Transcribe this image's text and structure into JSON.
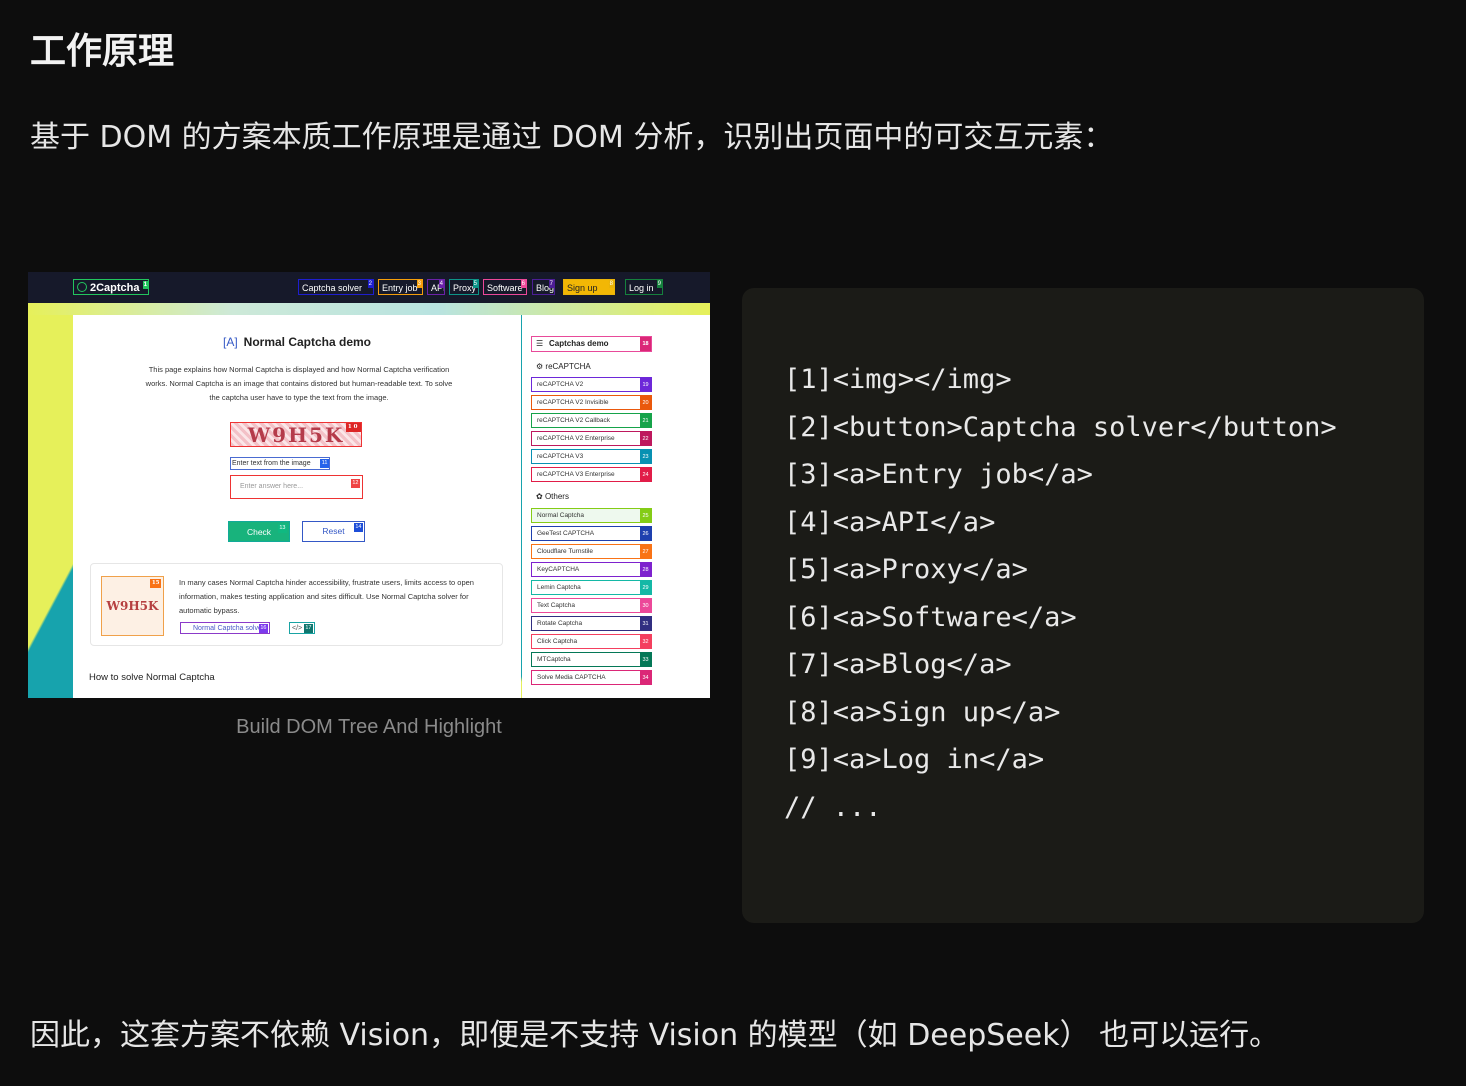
{
  "heading": "工作原理",
  "intro": "基于 DOM 的方案本质工作原理是通过 DOM 分析，识别出页面中的可交互元素：",
  "figure": {
    "caption": "Build DOM Tree And Highlight",
    "nav": {
      "logo": "2Captcha",
      "logo_badge": "1",
      "items": [
        {
          "label": "Captcha solver",
          "badge": "2"
        },
        {
          "label": "Entry job",
          "badge": "3"
        },
        {
          "label": "API",
          "badge": "4"
        },
        {
          "label": "Proxy",
          "badge": "5"
        },
        {
          "label": "Software",
          "badge": "6"
        },
        {
          "label": "Blog",
          "badge": "7"
        },
        {
          "label": "Sign up",
          "badge": "8"
        },
        {
          "label": "Log in",
          "badge": "9"
        }
      ]
    },
    "demo": {
      "title": "Normal Captcha demo",
      "description": "This page explains how Normal Captcha is displayed and how Normal Captcha verification works. Normal Captcha is an image that contains distored but human-readable text. To solve the captcha user have to type the text from the image.",
      "captcha_text": "W9H5K",
      "captcha_badge": "10",
      "hint_label": "Enter text from the image",
      "hint_badge": "11",
      "answer_placeholder": "Enter answer here...",
      "answer_badge": "12",
      "check_label": "Check",
      "check_badge": "13",
      "reset_label": "Reset",
      "reset_badge": "14",
      "info_thumb_text": "W9H5K",
      "info_thumb_badge": "15",
      "info_text": "In many cases Normal Captcha hinder accessibility, frustrate users, limits access to open information, makes testing application and sites difficult. Use Normal Captcha solver for automatic bypass.",
      "info_link": "Normal Captcha solver",
      "info_link_badge": "16",
      "info_code": "</>",
      "info_code_badge": "17",
      "how_title": "How to solve Normal Captcha"
    },
    "sidebar": {
      "head": "Captchas demo",
      "head_badge": "18",
      "group1": "reCAPTCHA",
      "group1_items": [
        {
          "label": "reCAPTCHA V2",
          "badge": "19"
        },
        {
          "label": "reCAPTCHA V2 Invisible",
          "badge": "20"
        },
        {
          "label": "reCAPTCHA V2 Callback",
          "badge": "21"
        },
        {
          "label": "reCAPTCHA V2 Enterprise",
          "badge": "22"
        },
        {
          "label": "reCAPTCHA V3",
          "badge": "23"
        },
        {
          "label": "reCAPTCHA V3 Enterprise",
          "badge": "24"
        }
      ],
      "group2": "Others",
      "group2_items": [
        {
          "label": "Normal Captcha",
          "badge": "25"
        },
        {
          "label": "GeeTest CAPTCHA",
          "badge": "26"
        },
        {
          "label": "Cloudflare Turnstile",
          "badge": "27"
        },
        {
          "label": "KeyCAPTCHA",
          "badge": "28"
        },
        {
          "label": "Lemin Captcha",
          "badge": "29"
        },
        {
          "label": "Text Captcha",
          "badge": "30"
        },
        {
          "label": "Rotate Captcha",
          "badge": "31"
        },
        {
          "label": "Click Captcha",
          "badge": "32"
        },
        {
          "label": "MTCaptcha",
          "badge": "33"
        },
        {
          "label": "Solve Media CAPTCHA",
          "badge": "34"
        }
      ]
    }
  },
  "code_lines": [
    "[1]<img></img>",
    "[2]<button>Captcha solver</button>",
    "[3]<a>Entry job</a>",
    "[4]<a>API</a>",
    "[5]<a>Proxy</a>",
    "[6]<a>Software</a>",
    "[7]<a>Blog</a>",
    "[8]<a>Sign up</a>",
    "[9]<a>Log in</a>",
    "// ..."
  ],
  "outro": "因此，这套方案不依赖 Vision，即便是不支持 Vision 的模型（如 DeepSeek） 也可以运行。",
  "colors": {
    "background": "#0d0d0d",
    "code_block": "#1b1b17",
    "caption": "#8a8a8a",
    "highlight_colors": [
      "#22c55e",
      "#1e1ecf",
      "#f59e0b",
      "#6b21a8",
      "#0d9488",
      "#ec4899",
      "#4c1d95",
      "#eab308",
      "#15803d",
      "#dc2626",
      "#2563eb",
      "#ef4444",
      "#10b981",
      "#1d4ed8",
      "#f97316",
      "#7c3aed",
      "#0f766e",
      "#db2777",
      "#6d28d9",
      "#ea580c",
      "#16a34a",
      "#be185d",
      "#0891b2",
      "#e11d48",
      "#84cc16",
      "#1e40af",
      "#f97316",
      "#7e22ce",
      "#14b8a6",
      "#ec4899",
      "#312e81",
      "#f43f5e",
      "#047857",
      "#db2777"
    ]
  }
}
